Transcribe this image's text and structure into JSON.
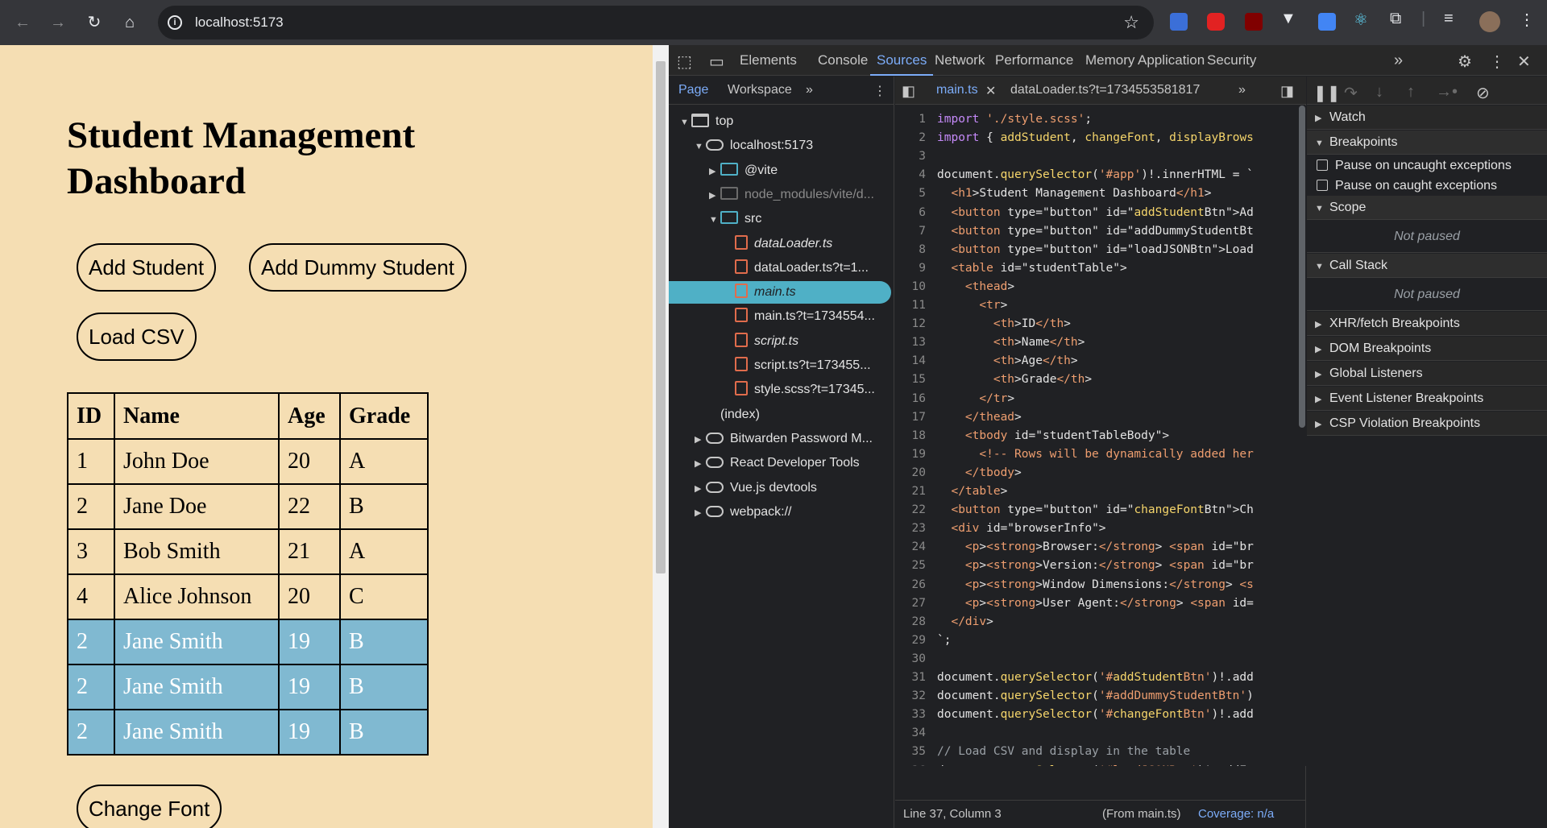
{
  "browser": {
    "url": "localhost:5173"
  },
  "page": {
    "title": "Student Management Dashboard",
    "buttons": {
      "add_student": "Add Student",
      "add_dummy": "Add Dummy Student",
      "load_csv": "Load CSV",
      "change_font": "Change Font"
    },
    "table": {
      "headers": [
        "ID",
        "Name",
        "Age",
        "Grade"
      ],
      "rows": [
        [
          "1",
          "John Doe",
          "20",
          "A"
        ],
        [
          "2",
          "Jane Doe",
          "22",
          "B"
        ],
        [
          "3",
          "Bob Smith",
          "21",
          "A"
        ],
        [
          "4",
          "Alice Johnson",
          "20",
          "C"
        ],
        [
          "2",
          "Jane Smith",
          "19",
          "B"
        ],
        [
          "2",
          "Jane Smith",
          "19",
          "B"
        ],
        [
          "2",
          "Jane Smith",
          "19",
          "B"
        ]
      ],
      "highlight_color": "#80b9d1"
    }
  },
  "devtools": {
    "tabs": [
      "Elements",
      "Console",
      "Sources",
      "Network",
      "Performance",
      "Memory",
      "Application",
      "Security"
    ],
    "active_tab": "Sources",
    "navigator": {
      "tabs": [
        "Page",
        "Workspace"
      ],
      "tree": [
        {
          "label": "top",
          "depth": 0,
          "icon": "window",
          "expanded": true
        },
        {
          "label": "localhost:5173",
          "depth": 1,
          "icon": "cloud",
          "expanded": true
        },
        {
          "label": "@vite",
          "depth": 2,
          "icon": "folder",
          "expanded": false
        },
        {
          "label": "node_modules/vite/d...",
          "depth": 2,
          "icon": "folder-gray",
          "expanded": false
        },
        {
          "label": "src",
          "depth": 2,
          "icon": "folder",
          "expanded": true
        },
        {
          "label": "dataLoader.ts",
          "depth": 3,
          "icon": "file",
          "italic": true
        },
        {
          "label": "dataLoader.ts?t=1...",
          "depth": 3,
          "icon": "file"
        },
        {
          "label": "main.ts",
          "depth": 3,
          "icon": "file",
          "italic": true,
          "selected": true
        },
        {
          "label": "main.ts?t=1734554...",
          "depth": 3,
          "icon": "file"
        },
        {
          "label": "script.ts",
          "depth": 3,
          "icon": "file",
          "italic": true
        },
        {
          "label": "script.ts?t=173455...",
          "depth": 3,
          "icon": "file"
        },
        {
          "label": "style.scss?t=17345...",
          "depth": 3,
          "icon": "file"
        },
        {
          "label": "(index)",
          "depth": 2,
          "icon": "page"
        },
        {
          "label": "Bitwarden Password M...",
          "depth": 1,
          "icon": "cloud",
          "expanded": false
        },
        {
          "label": "React Developer Tools",
          "depth": 1,
          "icon": "cloud",
          "expanded": false
        },
        {
          "label": "Vue.js devtools",
          "depth": 1,
          "icon": "cloud",
          "expanded": false
        },
        {
          "label": "webpack://",
          "depth": 1,
          "icon": "cloud",
          "expanded": false
        }
      ]
    },
    "editor": {
      "tabs": [
        "main.ts",
        "dataLoader.ts?t=1734553581817"
      ],
      "lines": [
        "import './style.scss';",
        "import { addStudent, changeFont, displayBrows",
        "",
        "document.querySelector('#app')!.innerHTML = `",
        "  <h1>Student Management Dashboard</h1>",
        "  <button type=\"button\" id=\"addStudentBtn\">Ad",
        "  <button type=\"button\" id=\"addDummyStudentBt",
        "  <button type=\"button\" id=\"loadJSONBtn\">Load",
        "  <table id=\"studentTable\">",
        "    <thead>",
        "      <tr>",
        "        <th>ID</th>",
        "        <th>Name</th>",
        "        <th>Age</th>",
        "        <th>Grade</th>",
        "      </tr>",
        "    </thead>",
        "    <tbody id=\"studentTableBody\">",
        "      <!-- Rows will be dynamically added her",
        "    </tbody>",
        "  </table>",
        "  <button type=\"button\" id=\"changeFontBtn\">Ch",
        "  <div id=\"browserInfo\">",
        "    <p><strong>Browser:</strong> <span id=\"br",
        "    <p><strong>Version:</strong> <span id=\"br",
        "    <p><strong>Window Dimensions:</strong> <s",
        "    <p><strong>User Agent:</strong> <span id=",
        "  </div>",
        "`;",
        "",
        "document.querySelector('#addStudentBtn')!.add",
        "document.querySelector('#addDummyStudentBtn')",
        "document.querySelector('#changeFontBtn')!.add",
        "",
        "// Load CSV and display in the table",
        "document.querySelector('#loadJSONBtn')!.addEv"
      ],
      "status_position": "Line 37, Column 3",
      "status_from": "(From main.ts)",
      "status_coverage": "Coverage: n/a"
    },
    "debugger": {
      "sections": [
        "Watch",
        "Breakpoints",
        "Scope",
        "Call Stack",
        "XHR/fetch Breakpoints",
        "DOM Breakpoints",
        "Global Listeners",
        "Event Listener Breakpoints",
        "CSP Violation Breakpoints"
      ],
      "pause_uncaught": "Pause on uncaught exceptions",
      "pause_caught": "Pause on caught exceptions",
      "not_paused": "Not paused"
    }
  }
}
